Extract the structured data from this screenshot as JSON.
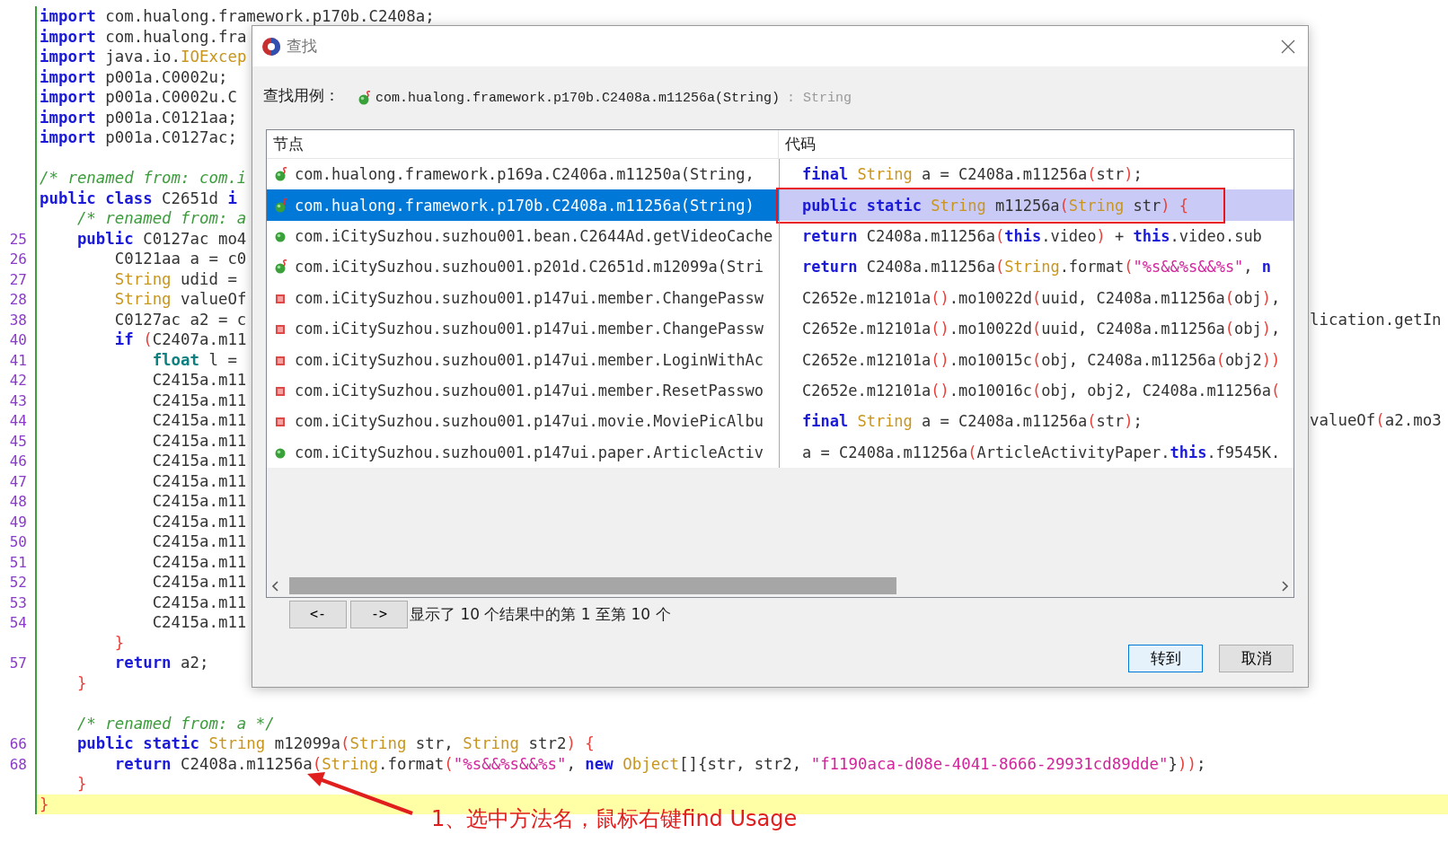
{
  "editor": {
    "lines": [
      {
        "code": [
          {
            "kind": "keyword",
            "text": "import"
          },
          " com.hualong.framework.p170b.C2408a;"
        ]
      },
      {
        "code": [
          {
            "kind": "keyword",
            "text": "import"
          },
          " com.hualong.fra"
        ]
      },
      {
        "code": [
          {
            "kind": "keyword",
            "text": "import"
          },
          " java.io.",
          {
            "kind": "type",
            "text": "IOExcep"
          }
        ]
      },
      {
        "code": [
          {
            "kind": "keyword",
            "text": "import"
          },
          " p001a.C0002u;"
        ]
      },
      {
        "code": [
          {
            "kind": "keyword",
            "text": "import"
          },
          " p001a.C0002u.C"
        ]
      },
      {
        "code": [
          {
            "kind": "keyword",
            "text": "import"
          },
          " p001a.C0121aa;"
        ]
      },
      {
        "code": [
          {
            "kind": "keyword",
            "text": "import"
          },
          " p001a.C0127ac;"
        ]
      },
      {
        "current": false
      },
      {
        "code": [
          {
            "kind": "comment",
            "text": "/* renamed from: com.i"
          }
        ]
      },
      {
        "code": [
          {
            "kind": "keyword",
            "text": "public class"
          },
          " C2651d ",
          {
            "kind": "keyword",
            "text": "i"
          }
        ]
      },
      {
        "code": [
          {
            "kind": "comment",
            "text": "    /* renamed from: a"
          }
        ]
      },
      {
        "number": "25",
        "code": [
          {
            "kind": "keyword",
            "text": "    public"
          },
          " C0127ac mo4"
        ]
      },
      {
        "number": "26",
        "code": [
          "        C0121aa a = c0"
        ]
      },
      {
        "number": "27",
        "code": [
          {
            "kind": "type",
            "text": "        String"
          },
          " udid ="
        ]
      },
      {
        "number": "28",
        "code": [
          {
            "kind": "type",
            "text": "        String"
          },
          " valueOf"
        ]
      },
      {
        "number": "38",
        "code": [
          "        C0127ac a2 = c"
        ],
        "right": [
          "lication.getIn"
        ]
      },
      {
        "number": "40",
        "code": [
          {
            "kind": "keyword",
            "text": "        if"
          },
          {
            "kind": "bracket",
            "text": " ("
          },
          "C2407a.m11"
        ]
      },
      {
        "number": "41",
        "code": [
          {
            "kind": "primitive",
            "text": "            float"
          },
          " l ="
        ]
      },
      {
        "number": "42",
        "code": [
          "            C2415a.m11"
        ]
      },
      {
        "number": "43",
        "code": [
          "            C2415a.m11"
        ]
      },
      {
        "number": "44",
        "code": [
          "            C2415a.m11"
        ],
        "right": [
          "valueOf",
          {
            "kind": "bracket",
            "text": "("
          },
          "a2.mo3"
        ]
      },
      {
        "number": "45",
        "code": [
          "            C2415a.m11"
        ]
      },
      {
        "number": "46",
        "code": [
          "            C2415a.m11"
        ]
      },
      {
        "number": "47",
        "code": [
          "            C2415a.m11"
        ]
      },
      {
        "number": "48",
        "code": [
          "            C2415a.m11"
        ]
      },
      {
        "number": "49",
        "code": [
          "            C2415a.m11"
        ]
      },
      {
        "number": "50",
        "code": [
          "            C2415a.m11"
        ]
      },
      {
        "number": "51",
        "code": [
          "            C2415a.m11"
        ]
      },
      {
        "number": "52",
        "code": [
          "            C2415a.m11"
        ]
      },
      {
        "number": "53",
        "code": [
          "            C2415a.m11"
        ]
      },
      {
        "number": "54",
        "code": [
          "            C2415a.m11"
        ]
      },
      {
        "code": [
          {
            "kind": "bracket",
            "text": "        }"
          }
        ]
      },
      {
        "number": "57",
        "code": [
          {
            "kind": "keyword",
            "text": "        return"
          },
          " a2;"
        ]
      },
      {
        "code": [
          {
            "kind": "bracket",
            "text": "    }"
          }
        ]
      },
      {
        "current": false
      },
      {
        "code": [
          {
            "kind": "comment",
            "text": "    /* renamed from: a */"
          }
        ]
      },
      {
        "number": "66",
        "code": [
          {
            "kind": "keyword",
            "text": "    public static"
          },
          {
            "kind": "type",
            "text": " String"
          },
          " m12099a",
          {
            "kind": "bracket",
            "text": "("
          },
          {
            "kind": "type",
            "text": "String"
          },
          " str, ",
          {
            "kind": "type",
            "text": "String"
          },
          " str2",
          {
            "kind": "bracket",
            "text": ") {"
          }
        ]
      },
      {
        "number": "68",
        "code": [
          {
            "kind": "keyword",
            "text": "        return"
          },
          " C2408a.m11256a",
          {
            "kind": "bracket",
            "text": "("
          },
          {
            "kind": "type",
            "text": "String"
          },
          ".format",
          {
            "kind": "bracket",
            "text": "("
          },
          {
            "kind": "string",
            "text": "\"%s&&%s&&%s\""
          },
          ", ",
          {
            "kind": "keyword",
            "text": "new"
          },
          {
            "kind": "type",
            "text": " Object"
          },
          "[]{str, str2, ",
          {
            "kind": "string",
            "text": "\"f1190aca-d08e-4041-8666-29931cd89dde\""
          },
          "}",
          {
            "kind": "bracket",
            "text": "))"
          },
          ";"
        ]
      },
      {
        "code": [
          {
            "kind": "bracket",
            "text": "    }"
          }
        ]
      },
      {
        "current": true,
        "code": [
          {
            "kind": "bracket",
            "text": "}"
          }
        ]
      }
    ]
  },
  "dialog": {
    "title": "查找",
    "query_label": "查找用例：",
    "query": "com.hualong.framework.p170b.C2408a.m11256a(String)",
    "query_type": ": String",
    "columns": [
      "节点",
      "代码"
    ],
    "results": [
      {
        "kind": "static-method",
        "selected": false,
        "annotated": false,
        "node": "com.hualong.framework.p169a.C2406a.m11250a(String,",
        "code": [
          {
            "kind": "keyword",
            "text": "final"
          },
          {
            "kind": "type",
            "text": " String"
          },
          " a = C2408a.m11256a",
          {
            "kind": "bracket",
            "text": "("
          },
          "str",
          {
            "kind": "bracket",
            "text": ")"
          },
          ";"
        ]
      },
      {
        "kind": "static-method",
        "selected": true,
        "annotated": true,
        "node": "com.hualong.framework.p170b.C2408a.m11256a(String)",
        "code": [
          {
            "kind": "keyword",
            "text": "public static"
          },
          {
            "kind": "type",
            "text": " String"
          },
          " m11256a",
          {
            "kind": "bracket",
            "text": "("
          },
          {
            "kind": "type",
            "text": "String"
          },
          " str",
          {
            "kind": "bracket",
            "text": ") {"
          }
        ]
      },
      {
        "kind": "method",
        "selected": false,
        "annotated": false,
        "node": "com.iCitySuzhou.suzhou001.bean.C2644Ad.getVideoCache",
        "code": [
          {
            "kind": "keyword",
            "text": "return"
          },
          " C2408a.m11256a",
          {
            "kind": "bracket",
            "text": "("
          },
          {
            "kind": "keyword",
            "text": "this"
          },
          ".video",
          {
            "kind": "bracket",
            "text": ")"
          },
          " + ",
          {
            "kind": "keyword",
            "text": "this"
          },
          ".video.sub"
        ]
      },
      {
        "kind": "static-method",
        "selected": false,
        "annotated": false,
        "node": "com.iCitySuzhou.suzhou001.p201d.C2651d.m12099a(Stri",
        "code": [
          {
            "kind": "keyword",
            "text": "return"
          },
          " C2408a.m11256a",
          {
            "kind": "bracket",
            "text": "("
          },
          {
            "kind": "type",
            "text": "String"
          },
          ".format",
          {
            "kind": "bracket",
            "text": "("
          },
          {
            "kind": "string",
            "text": "\"%s&&%s&&%s\""
          },
          ", ",
          {
            "kind": "keyword",
            "text": "n"
          }
        ]
      },
      {
        "kind": "field",
        "selected": false,
        "annotated": false,
        "node": "com.iCitySuzhou.suzhou001.p147ui.member.ChangePassw",
        "code": [
          "C2652e.m12101a",
          {
            "kind": "bracket",
            "text": "()"
          },
          ".mo10022d",
          {
            "kind": "bracket",
            "text": "("
          },
          "uuid, C2408a.m11256a",
          {
            "kind": "bracket",
            "text": "("
          },
          "obj",
          {
            "kind": "bracket",
            "text": ")"
          },
          ","
        ]
      },
      {
        "kind": "field",
        "selected": false,
        "annotated": false,
        "node": "com.iCitySuzhou.suzhou001.p147ui.member.ChangePassw",
        "code": [
          "C2652e.m12101a",
          {
            "kind": "bracket",
            "text": "()"
          },
          ".mo10022d",
          {
            "kind": "bracket",
            "text": "("
          },
          "uuid, C2408a.m11256a",
          {
            "kind": "bracket",
            "text": "("
          },
          "obj",
          {
            "kind": "bracket",
            "text": ")"
          },
          ","
        ]
      },
      {
        "kind": "field",
        "selected": false,
        "annotated": false,
        "node": "com.iCitySuzhou.suzhou001.p147ui.member.LoginWithAc",
        "code": [
          "C2652e.m12101a",
          {
            "kind": "bracket",
            "text": "()"
          },
          ".mo10015c",
          {
            "kind": "bracket",
            "text": "("
          },
          "obj, C2408a.m11256a",
          {
            "kind": "bracket",
            "text": "("
          },
          "obj2",
          {
            "kind": "bracket",
            "text": "))"
          }
        ]
      },
      {
        "kind": "field",
        "selected": false,
        "annotated": false,
        "node": "com.iCitySuzhou.suzhou001.p147ui.member.ResetPasswo",
        "code": [
          "C2652e.m12101a",
          {
            "kind": "bracket",
            "text": "()"
          },
          ".mo10016c",
          {
            "kind": "bracket",
            "text": "("
          },
          "obj, obj2, C2408a.m11256a",
          {
            "kind": "bracket",
            "text": "("
          }
        ]
      },
      {
        "kind": "field",
        "selected": false,
        "annotated": false,
        "node": "com.iCitySuzhou.suzhou001.p147ui.movie.MoviePicAlbu",
        "code": [
          {
            "kind": "keyword",
            "text": "final"
          },
          {
            "kind": "type",
            "text": " String"
          },
          " a = C2408a.m11256a",
          {
            "kind": "bracket",
            "text": "("
          },
          "str",
          {
            "kind": "bracket",
            "text": ")"
          },
          ";"
        ]
      },
      {
        "kind": "method",
        "selected": false,
        "annotated": false,
        "node": "com.iCitySuzhou.suzhou001.p147ui.paper.ArticleActiv",
        "code": [
          "a = C2408a.m11256a",
          {
            "kind": "bracket",
            "text": "("
          },
          "ArticleActivityPaper.",
          {
            "kind": "keyword",
            "text": "this"
          },
          ".f9545K."
        ]
      }
    ],
    "prev_button": "<-",
    "next_button": "->",
    "status": "显示了 10 个结果中的第 1 至第 10 个",
    "buttons": [
      {
        "label": "转到",
        "default": true
      },
      {
        "label": "取消",
        "default": false
      }
    ]
  },
  "annotation": {
    "text": "1、选中方法名，鼠标右键find Usage"
  }
}
